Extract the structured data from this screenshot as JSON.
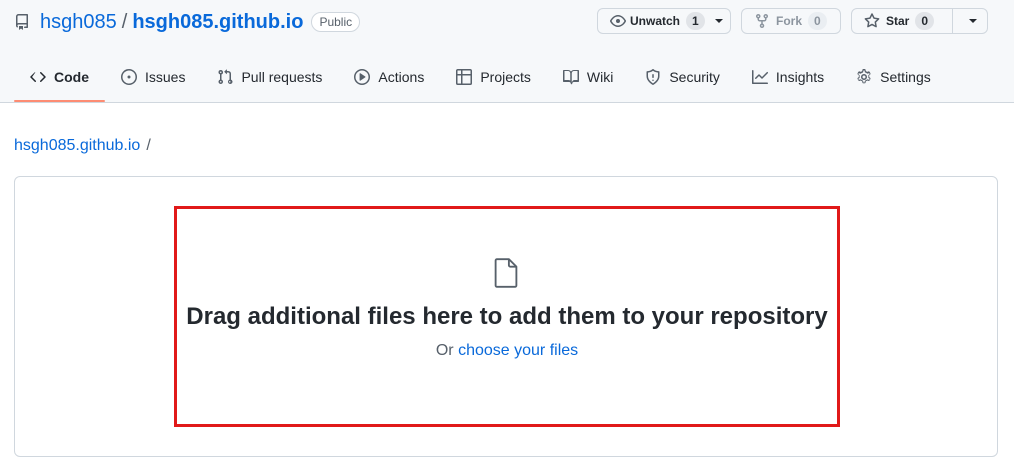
{
  "repo": {
    "owner": "hsgh085",
    "separator": "/",
    "name": "hsgh085.github.io",
    "visibility": "Public"
  },
  "actions": {
    "watch": {
      "label": "Unwatch",
      "count": "1",
      "icon": "eye-icon"
    },
    "fork": {
      "label": "Fork",
      "count": "0",
      "icon": "repo-forked-icon"
    },
    "star": {
      "label": "Star",
      "count": "0",
      "icon": "star-icon"
    }
  },
  "tabs": [
    {
      "label": "Code",
      "icon": "code-icon",
      "active": true
    },
    {
      "label": "Issues",
      "icon": "issue-opened-icon"
    },
    {
      "label": "Pull requests",
      "icon": "git-pull-request-icon"
    },
    {
      "label": "Actions",
      "icon": "play-icon"
    },
    {
      "label": "Projects",
      "icon": "table-icon"
    },
    {
      "label": "Wiki",
      "icon": "book-icon"
    },
    {
      "label": "Security",
      "icon": "shield-icon"
    },
    {
      "label": "Insights",
      "icon": "graph-icon"
    },
    {
      "label": "Settings",
      "icon": "gear-icon"
    }
  ],
  "breadcrumb": {
    "repo": "hsgh085.github.io",
    "separator": "/"
  },
  "upload": {
    "title": "Drag additional files here to add them to your repository",
    "prefix": "Or",
    "link": "choose your files"
  },
  "colors": {
    "link": "#0969da",
    "highlight_border": "#e11919",
    "active_tab_underline": "#fd8c73"
  }
}
